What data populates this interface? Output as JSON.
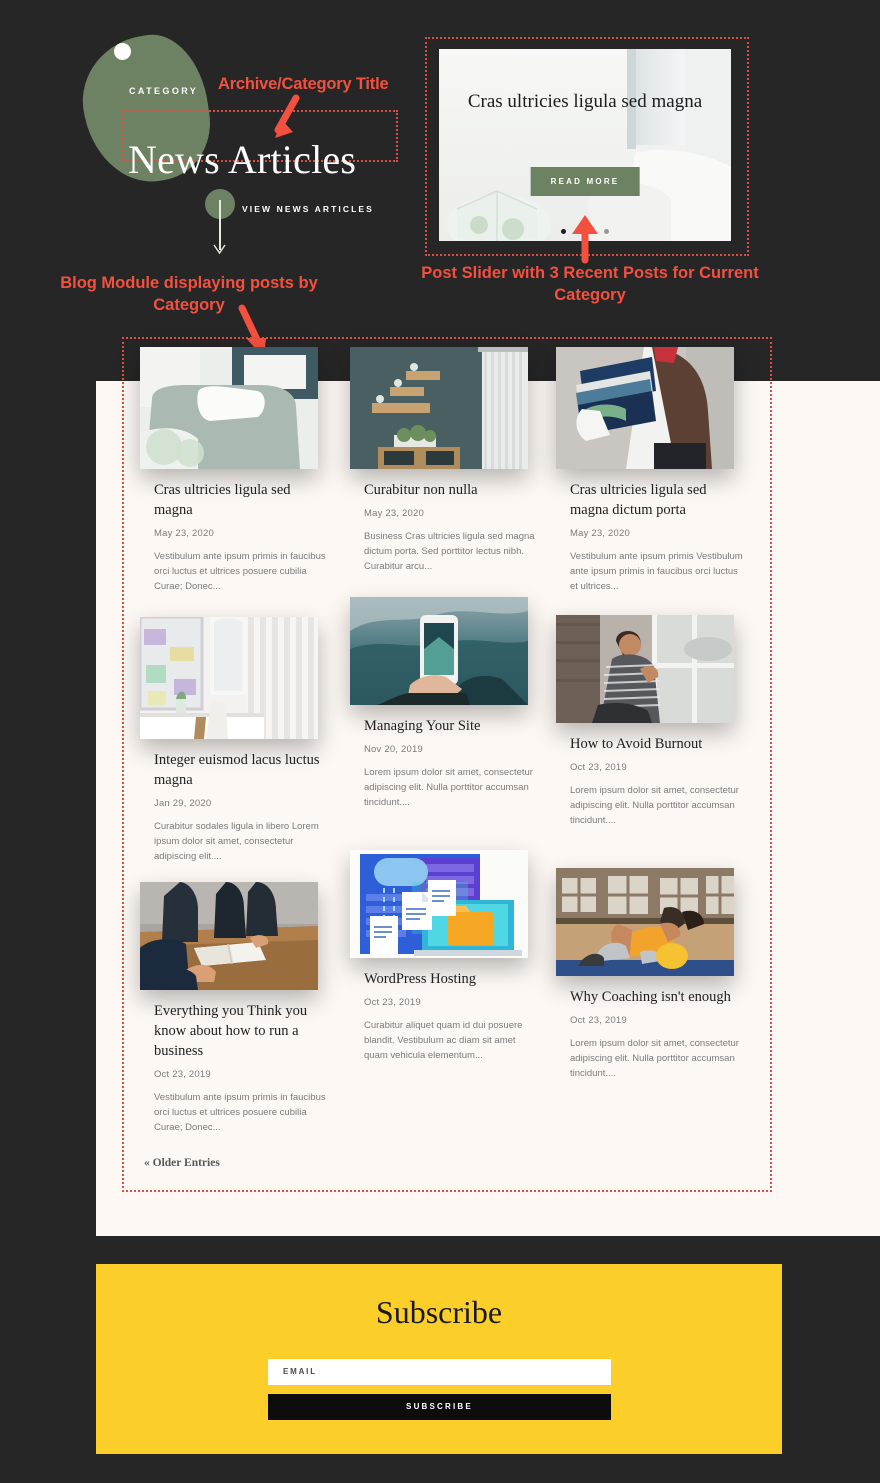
{
  "hero": {
    "category_label": "CATEGORY",
    "title": "News Articles",
    "scroll_label": "VIEW NEWS ARTICLES"
  },
  "annotations": {
    "title_note": "Archive/Category Title",
    "blog_note": "Blog Module displaying posts by Category",
    "slider_note": "Post Slider with 3 Recent Posts for Current Category"
  },
  "slider": {
    "title": "Cras ultricies ligula sed magna",
    "button_label": "READ MORE",
    "dots": 3,
    "active_dot": 1
  },
  "blog": {
    "pagination_label": "« Older Entries",
    "posts": [
      {
        "title": "Cras ultricies ligula sed magna",
        "date": "May 23, 2020",
        "excerpt": "Vestibulum ante ipsum primis in faucibus orci luctus et ultrices posuere cubilia Curae; Donec..."
      },
      {
        "title": "Curabitur non nulla",
        "date": "May 23, 2020",
        "excerpt": "Business Cras ultricies ligula sed magna dictum porta. Sed porttitor lectus nibh. Curabitur arcu..."
      },
      {
        "title": "Cras ultricies ligula sed magna dictum porta",
        "date": "May 23, 2020",
        "excerpt": "Vestibulum ante ipsum primis Vestibulum ante ipsum primis in faucibus orci luctus et ultrices..."
      },
      {
        "title": "Integer euismod lacus luctus magna",
        "date": "Jan 29, 2020",
        "excerpt": "Curabitur sodales ligula in libero Lorem ipsum dolor sit amet, consectetur adipiscing elit...."
      },
      {
        "title": "Managing Your Site",
        "date": "Nov 20, 2019",
        "excerpt": "Lorem ipsum dolor sit amet, consectetur adipiscing elit. Nulla porttitor accumsan tincidunt...."
      },
      {
        "title": "How to Avoid Burnout",
        "date": "Oct 23, 2019",
        "excerpt": "Lorem ipsum dolor sit amet, consectetur adipiscing elit. Nulla porttitor accumsan tincidunt...."
      },
      {
        "title": "Everything you Think you know about how to run a business",
        "date": "Oct 23, 2019",
        "excerpt": "Vestibulum ante ipsum primis in faucibus orci luctus et ultrices posuere cubilia Curae; Donec..."
      },
      {
        "title": "WordPress Hosting",
        "date": "Oct 23, 2019",
        "excerpt": "Curabitur aliquet quam id dui posuere blandit. Vestibulum ac diam sit amet quam vehicula elementum..."
      },
      {
        "title": "Why Coaching isn't enough",
        "date": "Oct 23, 2019",
        "excerpt": "Lorem ipsum dolor sit amet, consectetur adipiscing elit. Nulla porttitor accumsan tincidunt...."
      }
    ]
  },
  "subscribe": {
    "title": "Subscribe",
    "email_placeholder": "EMAIL",
    "button_label": "SUBSCRIBE"
  },
  "colors": {
    "page_background": "#262626",
    "content_background": "#fdf8f4",
    "accent_green": "#6d8263",
    "annotation_red": "#f4503f",
    "dotted_border": "#d94f45",
    "subscribe_yellow": "#fcce2a",
    "subscribe_button": "#0d0d0d"
  }
}
